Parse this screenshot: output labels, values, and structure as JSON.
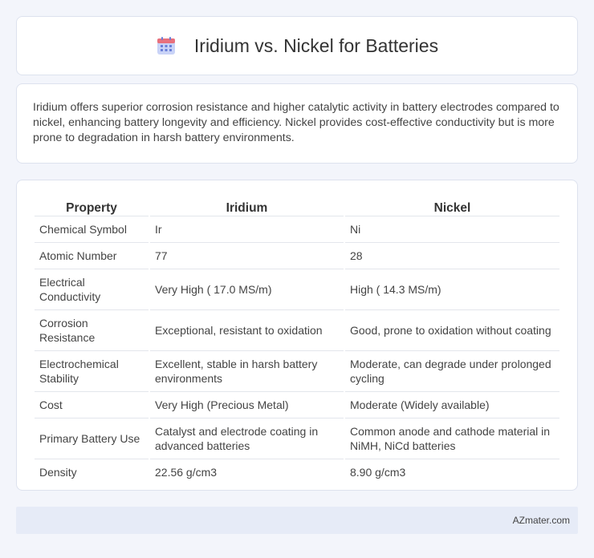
{
  "header": {
    "title": "Iridium vs. Nickel for Batteries",
    "icon": "calendar-icon",
    "icon_colors": {
      "top": "#e8707c",
      "body": "#c9d3f7",
      "dots": "#6a7fd8"
    }
  },
  "intro": {
    "text": "Iridium offers superior corrosion resistance and higher catalytic activity in battery electrodes compared to nickel, enhancing battery longevity and efficiency. Nickel provides cost-effective conductivity but is more prone to degradation in harsh battery environments."
  },
  "table": {
    "headers": [
      "Property",
      "Iridium",
      "Nickel"
    ],
    "rows": [
      [
        "Chemical Symbol",
        "Ir",
        "Ni"
      ],
      [
        "Atomic Number",
        "77",
        "28"
      ],
      [
        "Electrical Conductivity",
        "Very High ( 17.0 MS/m)",
        "High ( 14.3 MS/m)"
      ],
      [
        "Corrosion Resistance",
        "Exceptional, resistant to oxidation",
        "Good, prone to oxidation without coating"
      ],
      [
        "Electrochemical Stability",
        "Excellent, stable in harsh battery environments",
        "Moderate, can degrade under prolonged cycling"
      ],
      [
        "Cost",
        "Very High (Precious Metal)",
        "Moderate (Widely available)"
      ],
      [
        "Primary Battery Use",
        "Catalyst and electrode coating in advanced batteries",
        "Common anode and cathode material in NiMH, NiCd batteries"
      ],
      [
        "Density",
        "22.56 g/cm3",
        "8.90 g/cm3"
      ]
    ]
  },
  "footer": {
    "text": "AZmater.com"
  }
}
